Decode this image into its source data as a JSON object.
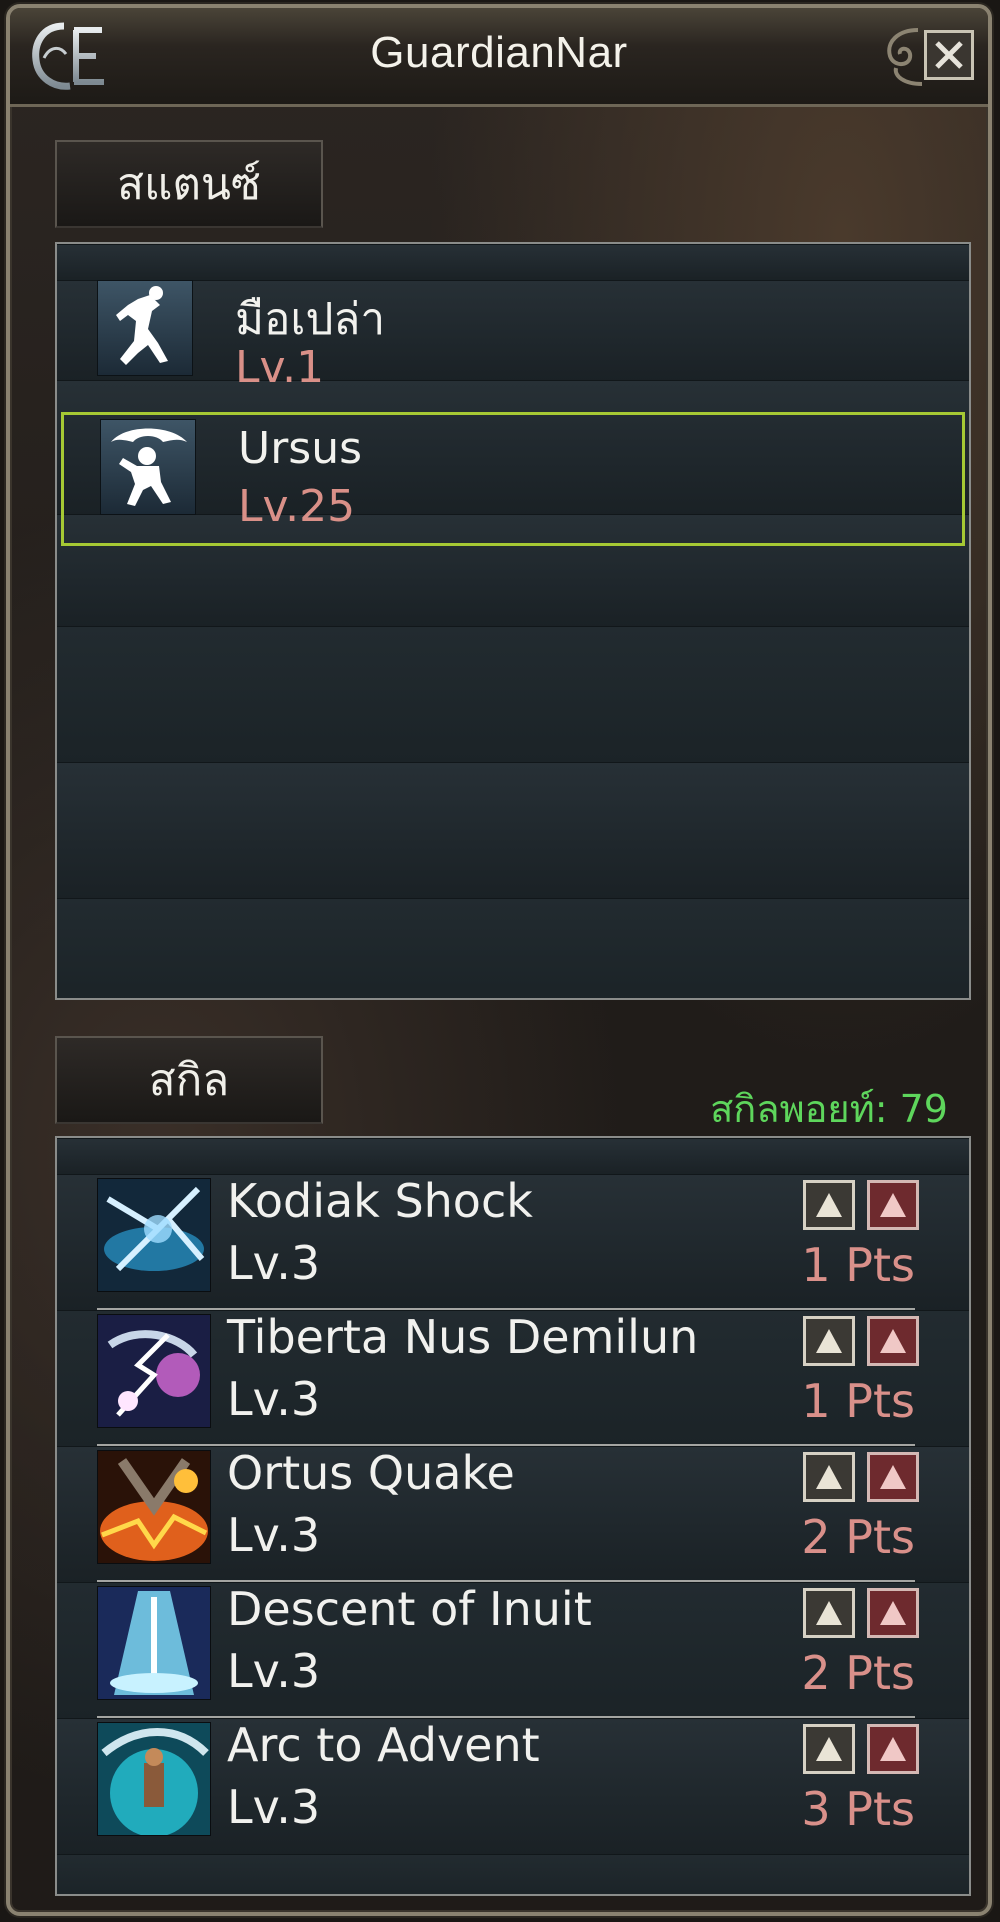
{
  "window": {
    "title": "GuardianNar"
  },
  "stance_section": {
    "tab_label": "สแตนซ์",
    "items": [
      {
        "name": "มือเปล่า",
        "level": "Lv.1",
        "icon": "unarmed-stance-icon",
        "selected": false
      },
      {
        "name": "Ursus",
        "level": "Lv.25",
        "icon": "ursus-stance-icon",
        "selected": true
      }
    ]
  },
  "skill_section": {
    "tab_label": "สกิล",
    "skill_points": "สกิลพอยท์: 79",
    "skills": [
      {
        "name": "Kodiak Shock",
        "level": "Lv.3",
        "pts": "1 Pts",
        "icon": "kodiak-shock-icon"
      },
      {
        "name": "Tiberta Nus Demilun",
        "level": "Lv.3",
        "pts": "1 Pts",
        "icon": "tiberta-nus-demilun-icon"
      },
      {
        "name": "Ortus Quake",
        "level": "Lv.3",
        "pts": "2 Pts",
        "icon": "ortus-quake-icon"
      },
      {
        "name": "Descent of Inuit",
        "level": "Lv.3",
        "pts": "2 Pts",
        "icon": "descent-of-inuit-icon"
      },
      {
        "name": "Arc to Advent",
        "level": "Lv.3",
        "pts": "3 Pts",
        "icon": "arc-to-advent-icon"
      }
    ]
  },
  "colors": {
    "selection_border": "#a6c934",
    "level_red": "#d99088",
    "skill_points_green": "#5ed65c"
  }
}
